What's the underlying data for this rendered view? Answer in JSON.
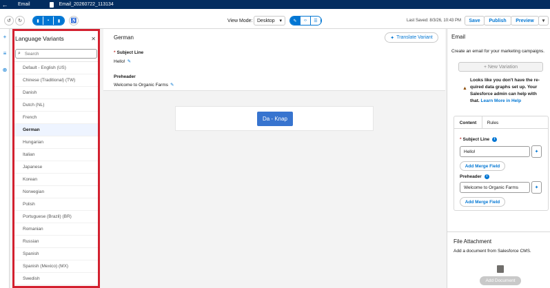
{
  "topbar": {
    "app_label": "Email",
    "file_name": "Email_20260722_113134"
  },
  "toolbar": {
    "view_mode_label": "View Mode:",
    "view_mode_value": "Desktop",
    "last_saved": "Last Saved: 8/3/26, 10:43 PM",
    "save_label": "Save",
    "publish_label": "Publish",
    "preview_label": "Preview"
  },
  "language_panel": {
    "title": "Language Variants",
    "search_placeholder": "Search",
    "selected": "German",
    "items": [
      "Default - English (US)",
      "Chinese (Traditional) (TW)",
      "Danish",
      "Dutch (NL)",
      "French",
      "German",
      "Hungarian",
      "Italian",
      "Japanese",
      "Korean",
      "Norwegian",
      "Polish",
      "Portuguese (Brazil) (BR)",
      "Romanian",
      "Russian",
      "Spanish",
      "Spanish (Mexico) (MX)",
      "Swedish"
    ]
  },
  "editor": {
    "title": "German",
    "translate_button": "Translate Variant",
    "subject_label": "Subject Line",
    "subject_value": "Hello!",
    "preheader_label": "Preheader",
    "preheader_value": "Welcome to Organic Farms",
    "cta_label": "Da - Knap"
  },
  "right_panel": {
    "title": "Email",
    "description": "Create an email for your marketing campaigns.",
    "new_variation_label": "+ New Variation",
    "warning_text": "Looks like you don't have the re-quired data graphs set up. Your Salesforce admin can help with that.",
    "warning_link": "Learn More in Help",
    "tabs": [
      "Content",
      "Rules"
    ],
    "subject_label": "Subject Line",
    "subject_value": "Hello!",
    "preheader_label": "Preheader",
    "preheader_value": "Welcome to Organic Farms",
    "merge_field_label": "Add Merge Field",
    "file_title": "File Attachment",
    "file_desc": "Add a document from Salesforce CMS.",
    "add_document_label": "Add Document"
  },
  "colors": {
    "topbar": "#032d60",
    "brand": "#0176d3",
    "highlight_border": "#d3202f",
    "cta": "#3774cf"
  }
}
